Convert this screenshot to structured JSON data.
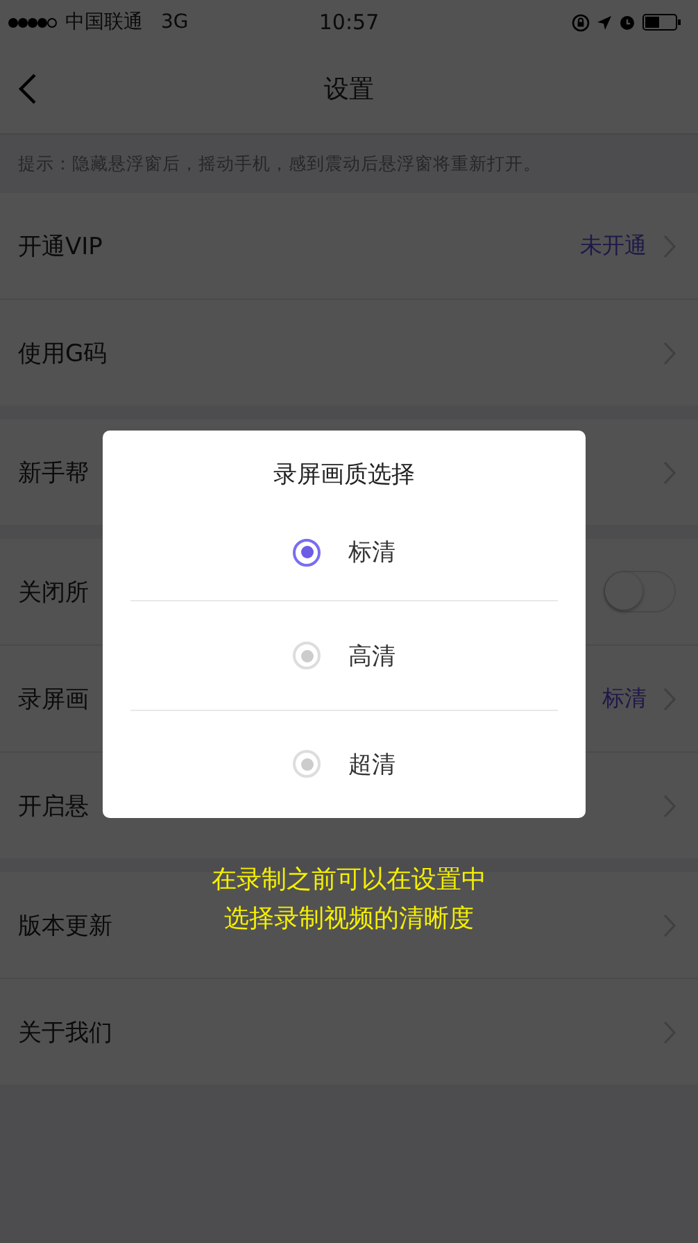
{
  "status_bar": {
    "carrier": "中国联通",
    "network": "3G",
    "time": "10:57"
  },
  "nav": {
    "title": "设置"
  },
  "hint": "提示：隐藏悬浮窗后，摇动手机，感到震动后悬浮窗将重新打开。",
  "groups": [
    {
      "rows": [
        {
          "kind": "link",
          "label": "开通VIP",
          "value": "未开通"
        },
        {
          "kind": "link",
          "label": "使用G码"
        }
      ]
    },
    {
      "rows": [
        {
          "kind": "link",
          "label": "新手帮"
        }
      ]
    },
    {
      "rows": [
        {
          "kind": "toggle",
          "label": "关闭所",
          "on": false
        },
        {
          "kind": "link",
          "label": "录屏画",
          "value": "标清"
        },
        {
          "kind": "link",
          "label": "开启悬"
        }
      ]
    },
    {
      "rows": [
        {
          "kind": "link",
          "label": "版本更新"
        },
        {
          "kind": "link",
          "label": "关于我们"
        }
      ]
    }
  ],
  "dialog": {
    "title": "录屏画质选择",
    "options": [
      {
        "label": "标清",
        "selected": true
      },
      {
        "label": "高清",
        "selected": false
      },
      {
        "label": "超清",
        "selected": false
      }
    ]
  },
  "caption": [
    "在录制之前可以在设置中",
    "选择录制视频的清晰度"
  ]
}
